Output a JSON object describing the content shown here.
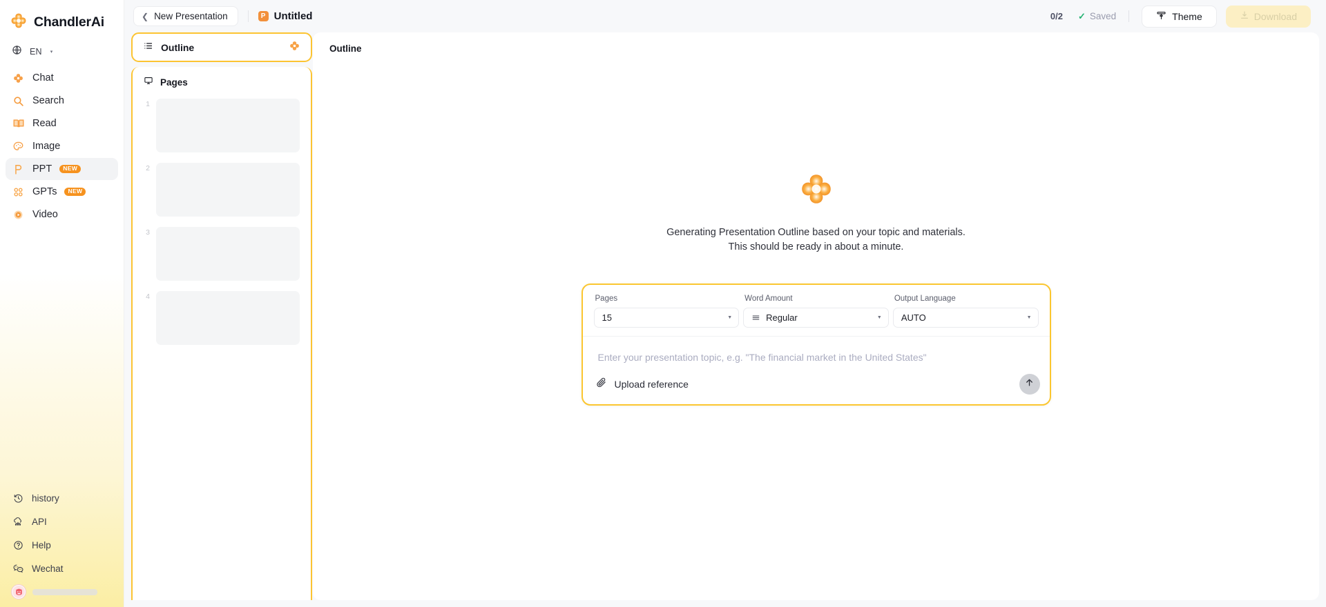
{
  "brand": {
    "name": "ChandlerAi",
    "logo_icon": "chandler-flower-logo"
  },
  "sidebar": {
    "language": {
      "label": "EN",
      "icon": "globe-icon",
      "caret": "▾"
    },
    "items": [
      {
        "label": "Chat",
        "icon": "chat-flower-icon",
        "badge": ""
      },
      {
        "label": "Search",
        "icon": "search-icon",
        "badge": ""
      },
      {
        "label": "Read",
        "icon": "book-icon",
        "badge": ""
      },
      {
        "label": "Image",
        "icon": "palette-icon",
        "badge": ""
      },
      {
        "label": "PPT",
        "icon": "ppt-p-icon",
        "badge": "NEW"
      },
      {
        "label": "GPTs",
        "icon": "grid-dots-icon",
        "badge": "NEW"
      },
      {
        "label": "Video",
        "icon": "video-play-icon",
        "badge": ""
      }
    ],
    "bottom_items": [
      {
        "label": "history",
        "icon": "clock-history-icon"
      },
      {
        "label": "API",
        "icon": "cloud-api-icon"
      },
      {
        "label": "Help",
        "icon": "question-circle-icon"
      },
      {
        "label": "Wechat",
        "icon": "wechat-icon"
      }
    ],
    "user": {
      "avatar_icon": "user-avatar",
      "name_redacted": ""
    }
  },
  "header": {
    "back_label": "New Presentation",
    "back_icon": "chevron-left-icon",
    "doc_badge": "P",
    "doc_title": "Untitled",
    "count": "0/2",
    "saved_label": "Saved",
    "saved_icon": "check-icon",
    "theme_label": "Theme",
    "theme_icon": "paint-roller-icon",
    "download_label": "Download",
    "download_icon": "download-icon",
    "download_disabled": true
  },
  "outline_panel": {
    "tab_label": "Outline",
    "tab_icon": "list-icon",
    "tab_logo_icon": "chandler-flower-logo",
    "pages_label": "Pages",
    "pages_icon": "monitor-icon",
    "thumbnails": [
      "1",
      "2",
      "3",
      "4"
    ]
  },
  "content": {
    "heading": "Outline",
    "logo_icon": "chandler-flower-logo",
    "status_line_1": "Generating Presentation Outline based on your topic and materials.",
    "status_line_2": "This should be ready in about a minute."
  },
  "prompt": {
    "pages": {
      "label": "Pages",
      "value": "15"
    },
    "word_amount": {
      "label": "Word Amount",
      "value": "Regular",
      "icon": "lines-icon"
    },
    "output_language": {
      "label": "Output Language",
      "value": "AUTO"
    },
    "topic_placeholder": "Enter your presentation topic, e.g. \"The financial market in the United States\"",
    "upload_label": "Upload reference",
    "upload_icon": "paperclip-icon",
    "send_icon": "arrow-up-icon"
  },
  "colors": {
    "accent_yellow": "#fbc62f",
    "accent_orange": "#f2903b",
    "saved_green": "#25b372",
    "canvas": "#f7f8fa"
  }
}
